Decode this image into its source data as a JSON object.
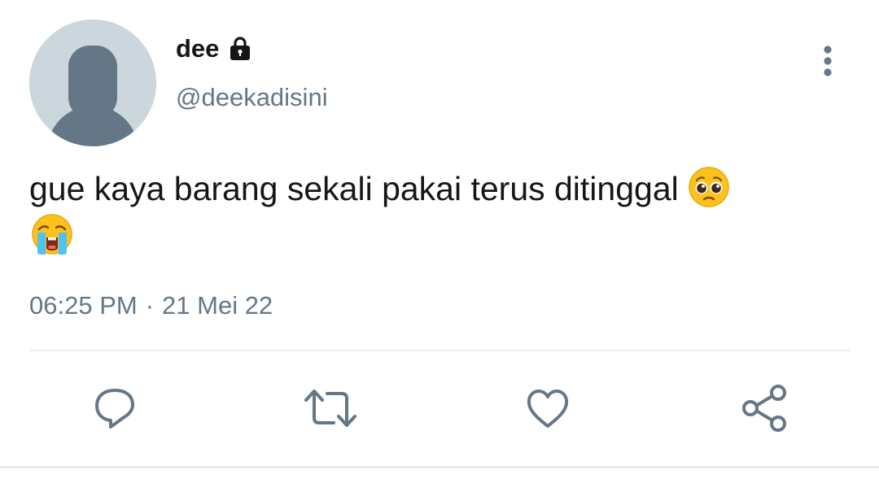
{
  "tweet": {
    "display_name": "dee",
    "handle": "@deekadisini",
    "text": "gue kaya barang sekali pakai terus ditinggal",
    "time": "06:25 PM",
    "separator": "·",
    "date": "21 Mei 22"
  },
  "icons": {
    "avatar": "default-avatar-icon",
    "protected": "lock-icon",
    "more": "more-vertical-icon",
    "emoji_1": "pleading-face-emoji",
    "emoji_2": "loudly-crying-face-emoji",
    "reply": "reply-icon",
    "retweet": "retweet-icon",
    "like": "heart-icon",
    "share": "share-icon"
  },
  "colors": {
    "text_primary": "#14171a",
    "text_secondary": "#657786",
    "icon": "#657786",
    "avatar_bg": "#ccd6dd",
    "divider": "#e6ecf0"
  }
}
